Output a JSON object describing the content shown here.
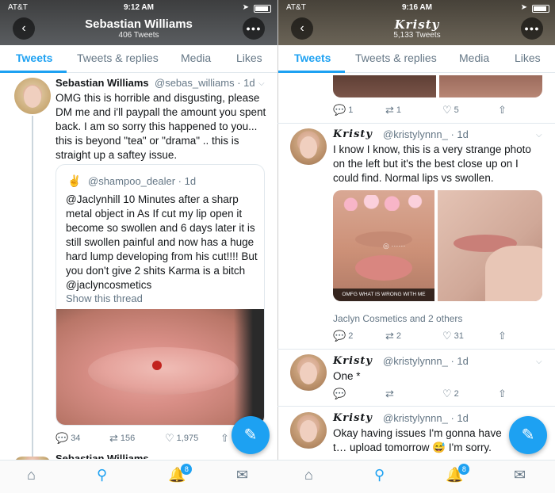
{
  "left": {
    "status": {
      "carrier": "AT&T",
      "time": "9:12 AM"
    },
    "header": {
      "title": "Sebastian Williams",
      "subtitle": "406 Tweets"
    },
    "tabs": [
      "Tweets",
      "Tweets & replies",
      "Media",
      "Likes"
    ],
    "tweet": {
      "name": "Sebastian Williams",
      "handle": "@sebas_williams · 1d",
      "text": "OMG this is horrible and disgusting, please DM me and i'll paypall the amount you spent back. I am so sorry this happened to you... this is beyond \"tea\" or \"drama\" .. this is straight up a saftey issue.",
      "quote": {
        "handle": "@shampoo_dealer · 1d",
        "text": "@Jaclynhill 10 Minutes after a sharp metal object in As If cut my lip open it become so swollen and 6 days later it is still swollen painful and now has a huge hard lump developing from his cut!!!! But you don't give 2 shits Karma is a bitch @jaclyncosmetics",
        "show_thread": "Show this thread"
      },
      "replies": "34",
      "retweets": "156",
      "likes": "1,975"
    },
    "next_name": "Sebastian Williams",
    "notif_badge": "8"
  },
  "right": {
    "status": {
      "carrier": "AT&T",
      "time": "9:16 AM"
    },
    "header": {
      "title": "Kristy",
      "subtitle": "5,133 Tweets"
    },
    "tabs": [
      "Tweets",
      "Tweets & replies",
      "Media",
      "Likes"
    ],
    "prev_actions": {
      "replies": "1",
      "retweets": "1",
      "likes": "5"
    },
    "tweet1": {
      "name": "Kristy",
      "handle": "@kristylynnn_ · 1d",
      "text": "I know I know, this is a very strange photo on the left but it's the best close up on I could find.  Normal lips vs swollen.",
      "photo_caption": "OMFG WHAT IS WRONG WITH ME",
      "context": "Jaclyn Cosmetics and 2 others",
      "replies": "2",
      "retweets": "2",
      "likes": "31"
    },
    "tweet2": {
      "name": "Kristy",
      "handle": "@kristylynnn_ · 1d",
      "text": "One *",
      "likes": "2"
    },
    "tweet3": {
      "name": "Kristy",
      "handle": "@kristylynnn_ · 1d",
      "text": "Okay having issues I'm gonna have t… upload tomorrow 😅 I'm sorry."
    },
    "notif_badge": "8"
  },
  "colors": {
    "accent": "#1da1f2",
    "muted": "#657786"
  }
}
